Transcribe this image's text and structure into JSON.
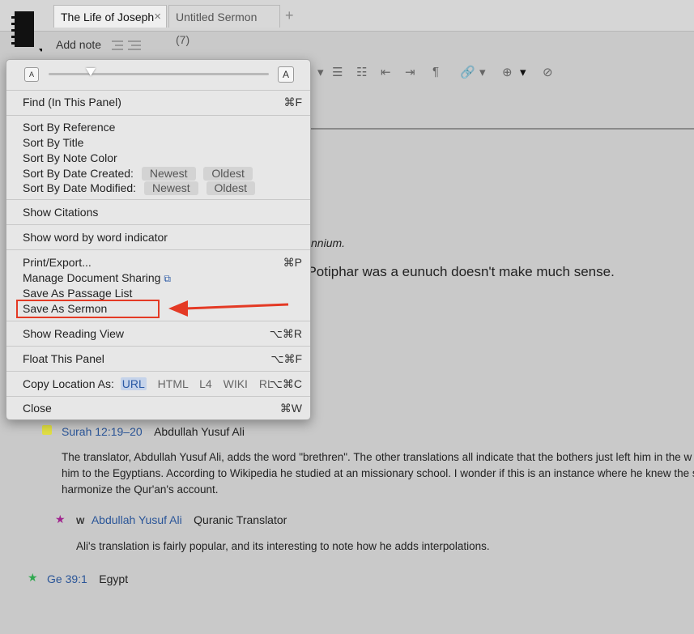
{
  "tabs": [
    {
      "label": "The Life of Joseph",
      "active": true
    },
    {
      "label": "Untitled Sermon (7)",
      "active": false
    }
  ],
  "tab_add": "+",
  "toolbar": {
    "add_note": "Add note"
  },
  "content": {
    "fragment1": "llennium.",
    "fragment2": "t Potiphar was a eunuch doesn't make much sense."
  },
  "notes": [
    {
      "ref": "Surah 12:19–20",
      "title": "Abdullah Yusuf Ali",
      "paragraph": [
        "The translator, Abdullah Yusuf Ali, adds the word \"brethren\". The other translations all indicate that the bothers just left him in the w",
        "him to the Egyptians. According to Wikipedia he studied at an missionary school. I wonder if this is an instance where he knew the s",
        "harmonize the Qur'an's account."
      ],
      "sub": {
        "marker": "W",
        "ref": "Abdullah Yusuf Ali",
        "title": "Quranic Translator",
        "text": "Ali's translation is fairly popular, and its interesting to note how he adds interpolations."
      }
    },
    {
      "ref": "Ge 39:1",
      "title": "Egypt"
    }
  ],
  "menu": {
    "font_small": "A",
    "font_large": "A",
    "font_size_level": 0.19,
    "find": {
      "label": "Find (In This Panel)",
      "shortcut": "⌘F"
    },
    "sort_reference": "Sort By Reference",
    "sort_title": "Sort By Title",
    "sort_note_color": "Sort By Note Color",
    "sort_date_created": "Sort By Date Created:",
    "sort_date_modified": "Sort By Date Modified:",
    "newest": "Newest",
    "oldest": "Oldest",
    "show_citations": "Show Citations",
    "show_word_indicator": "Show word by word indicator",
    "print_export": {
      "label": "Print/Export...",
      "shortcut": "⌘P"
    },
    "manage_sharing": "Manage Document Sharing",
    "save_passage_list": "Save As Passage List",
    "save_sermon": "Save As Sermon",
    "reading_view": {
      "label": "Show Reading View",
      "shortcut": "⌥⌘R"
    },
    "float_panel": {
      "label": "Float This Panel",
      "shortcut": "⌥⌘F"
    },
    "copy_location": {
      "label": "Copy Location As:",
      "options": [
        "URL",
        "HTML",
        "L4",
        "WIKI",
        "RL"
      ],
      "selected": "URL",
      "shortcut": "⌥⌘C"
    },
    "close": {
      "label": "Close",
      "shortcut": "⌘W"
    }
  },
  "colors": {
    "accent_red": "#e43a25",
    "link_blue": "#2a5598",
    "sticky_yellow": "#e1df44"
  }
}
